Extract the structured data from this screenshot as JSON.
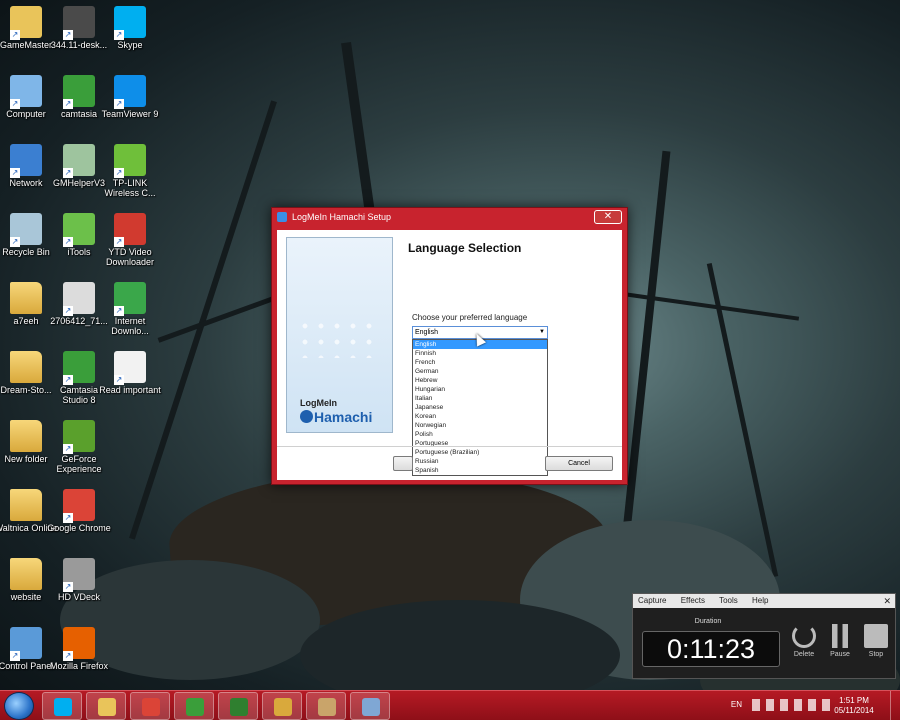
{
  "desktop": {
    "icons": [
      {
        "label": "GameMaster",
        "icon": "game-icon",
        "color": "#e9c45a"
      },
      {
        "label": "344.11-desk...",
        "icon": "nvidia-icon",
        "color": "#4a4a4a"
      },
      {
        "label": "Skype",
        "icon": "skype-icon",
        "color": "#00aff0"
      },
      {
        "label": "Computer",
        "icon": "computer-icon",
        "color": "#7fb6e8"
      },
      {
        "label": "camtasia",
        "icon": "camtasia-icon",
        "color": "#3a9e3a"
      },
      {
        "label": "TeamViewer 9",
        "icon": "teamviewer-icon",
        "color": "#0e8ee9"
      },
      {
        "label": "Network",
        "icon": "network-icon",
        "color": "#3b7fd1"
      },
      {
        "label": "GMHelperV3",
        "icon": "app-window-icon",
        "color": "#9ec49e"
      },
      {
        "label": "TP-LINK Wireless C...",
        "icon": "wifi-icon",
        "color": "#6fbf3a"
      },
      {
        "label": "Recycle Bin",
        "icon": "recycle-bin-icon",
        "color": "#a9c6d8"
      },
      {
        "label": "iTools",
        "icon": "itools-icon",
        "color": "#6cc04a"
      },
      {
        "label": "YTD Video Downloader",
        "icon": "ytd-icon",
        "color": "#d13a2f"
      },
      {
        "label": "a7eeh",
        "icon": "folder-icon",
        "color": "#e9c45a"
      },
      {
        "label": "2706412_71...",
        "icon": "image-file-icon",
        "color": "#dcdcdc"
      },
      {
        "label": "Internet Downlo...",
        "icon": "idm-icon",
        "color": "#3aa74a"
      },
      {
        "label": "Dream-Sto...",
        "icon": "folder-icon",
        "color": "#e9c45a"
      },
      {
        "label": "Camtasia Studio 8",
        "icon": "camtasia-icon",
        "color": "#3a9e3a"
      },
      {
        "label": "Read important",
        "icon": "text-file-icon",
        "color": "#f2f2f2"
      },
      {
        "label": "New folder",
        "icon": "folder-icon",
        "color": "#e9c45a"
      },
      {
        "label": "GeForce Experience",
        "icon": "geforce-icon",
        "color": "#5aa02c"
      },
      {
        "label": "Waltnica Online",
        "icon": "folder-icon",
        "color": "#e9c45a"
      },
      {
        "label": "Google Chrome",
        "icon": "chrome-icon",
        "color": "#db4437"
      },
      {
        "label": "website",
        "icon": "folder-icon",
        "color": "#e9c45a"
      },
      {
        "label": "HD VDeck",
        "icon": "hd-vdeck-icon",
        "color": "#9a9a9a"
      },
      {
        "label": "Control Panel",
        "icon": "control-panel-icon",
        "color": "#5a9ad8"
      },
      {
        "label": "Mozilla Firefox",
        "icon": "firefox-icon",
        "color": "#e66000"
      }
    ]
  },
  "dialog": {
    "title": "LogMeIn Hamachi Setup",
    "close_glyph": "✕",
    "brand_line1": "LogMeIn",
    "brand_line2": "Hamachi",
    "heading": "Language Selection",
    "prompt": "Choose your preferred language",
    "selected_language": "English",
    "dropdown_arrow": "▼",
    "languages": [
      "English",
      "Finnish",
      "French",
      "German",
      "Hebrew",
      "Hungarian",
      "Italian",
      "Japanese",
      "Korean",
      "Norwegian",
      "Polish",
      "Portuguese",
      "Portuguese (Brazilian)",
      "Russian",
      "Spanish"
    ],
    "cancel_label": "Cancel"
  },
  "recorder": {
    "menu": [
      "Capture",
      "Effects",
      "Tools",
      "Help"
    ],
    "close_glyph": "✕",
    "duration_label": "Duration",
    "timer": "0:11:23",
    "delete_label": "Delete",
    "pause_label": "Pause",
    "stop_label": "Stop"
  },
  "taskbar": {
    "pinned": [
      {
        "icon": "skype-icon",
        "color": "#00aff0"
      },
      {
        "icon": "file-explorer-icon",
        "color": "#e9c45a"
      },
      {
        "icon": "chrome-icon",
        "color": "#db4437"
      },
      {
        "icon": "camtasia-icon",
        "color": "#3a9e3a"
      },
      {
        "icon": "camtasia-recorder-icon",
        "color": "#2f7f2f"
      },
      {
        "icon": "installer-icon",
        "color": "#d9a93c"
      },
      {
        "icon": "tools-icon",
        "color": "#c9a46a"
      },
      {
        "icon": "setup-icon",
        "color": "#7fa7d4"
      }
    ],
    "language": "EN",
    "time": "1:51 PM",
    "date": "05/11/2014"
  }
}
